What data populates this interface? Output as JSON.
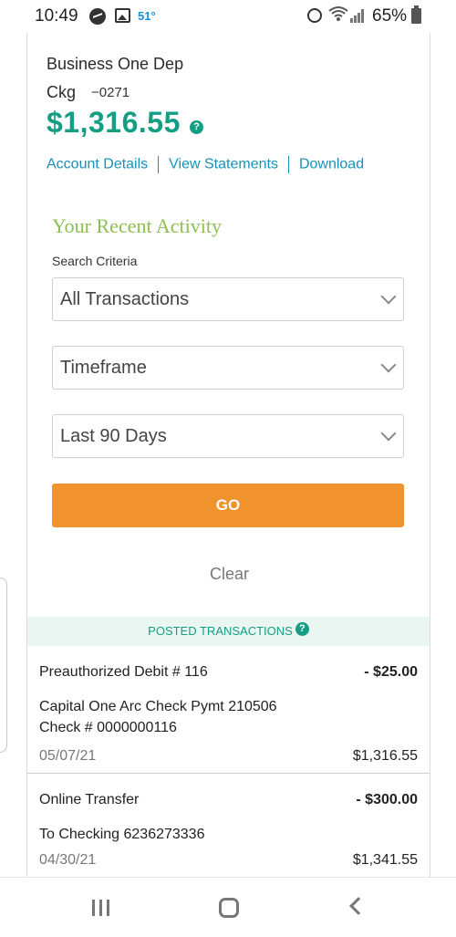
{
  "status_bar": {
    "time": "10:49",
    "temperature": "51°",
    "battery": "65%",
    "icons": [
      "messenger-icon",
      "gallery-icon",
      "alarm-icon",
      "wifi-icon",
      "signal-icon",
      "battery-icon"
    ]
  },
  "account": {
    "name": "Business One Dep",
    "type": "Ckg",
    "number": "−0271",
    "balance": "$1,316.55",
    "help_glyph": "?",
    "links": [
      "Account Details",
      "View Statements",
      "Download"
    ]
  },
  "activity": {
    "title": "Your Recent Activity",
    "criteria_label": "Search Criteria",
    "filters": [
      {
        "selected": "All Transactions"
      },
      {
        "selected": "Timeframe"
      },
      {
        "selected": "Last 90 Days"
      }
    ],
    "go_label": "GO",
    "clear_label": "Clear"
  },
  "posted": {
    "header": "POSTED TRANSACTIONS",
    "help_glyph": "?",
    "transactions": [
      {
        "description": "Preauthorized Debit # 116",
        "amount": "- $25.00",
        "detail_lines": [
          "Capital One Arc Check Pymt 210506",
          "Check # 0000000116"
        ],
        "date": "05/07/21",
        "balance": "$1,316.55"
      },
      {
        "description": "Online Transfer",
        "amount": "- $300.00",
        "detail_lines": [
          "To Checking 6236273336"
        ],
        "date": "04/30/21",
        "balance": "$1,341.55"
      }
    ]
  },
  "colors": {
    "accent_green": "#159e84",
    "title_green": "#8cc052",
    "link_blue": "#1791b8",
    "go_orange": "#f0922e",
    "posted_bg": "#e9f6f2"
  },
  "nav_bar": {
    "icons": [
      "recents-icon",
      "home-icon",
      "back-icon"
    ]
  }
}
